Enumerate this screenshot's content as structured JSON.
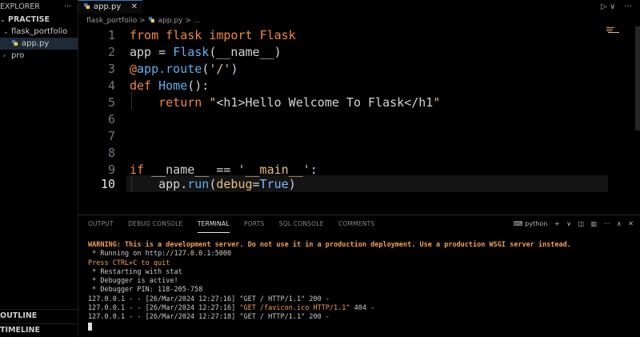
{
  "sidebar": {
    "header": "EXPLORER",
    "header_more": "···",
    "section": "PRACTISE",
    "items": [
      {
        "label": "flask_portfolio",
        "type": "folder",
        "expanded": true
      },
      {
        "label": "app.py",
        "type": "python-file",
        "selected": true
      },
      {
        "label": "pro",
        "type": "folder",
        "expanded": false
      }
    ],
    "outline": "OUTLINE",
    "timeline": "TIMELINE"
  },
  "tab": {
    "label": "app.py",
    "close": "✕"
  },
  "tab_actions": {
    "run": "▷",
    "chev": "∨",
    "more": "···"
  },
  "breadcrumb": {
    "folder": "flask_portfolio",
    "sep": ">",
    "file": "app.py",
    "tail": "> ..."
  },
  "editor": {
    "current_line": 10,
    "line_numbers": [
      "1",
      "2",
      "3",
      "4",
      "5",
      "6",
      "7",
      "8",
      "9",
      "10"
    ]
  },
  "panel": {
    "tabs": [
      "OUTPUT",
      "DEBUG CONSOLE",
      "TERMINAL",
      "PORTS",
      "SQL CONSOLE",
      "COMMENTS"
    ],
    "active_tab": "TERMINAL",
    "shell": "python",
    "actions": {
      "add": "+",
      "split": "◫",
      "trash": "🗑",
      "more": "···",
      "max": "∧",
      "close": "✕"
    }
  },
  "terminal": {
    "warning": "WARNING: This is a development server. Do not use it in a production deployment. Use a production WSGI server instead.",
    "running": " * Running on http://127.0.0.1:5000",
    "quit": "Press CTRL+C to quit",
    "restart": " * Restarting with stat",
    "debugger": " * Debugger is active!",
    "pin": " * Debugger PIN: 118-205-758",
    "log1": "127.0.0.1 - - [26/Mar/2024 12:27:16] \"GET / HTTP/1.1\" 200 -",
    "log2_a": "127.0.0.1 - - [26/Mar/2024 12:27:16] ",
    "log2_b": "\"GET /favicon.ico HTTP/1.1\"",
    "log2_c": " 404 -",
    "log3": "127.0.0.1 - - [26/Mar/2024 12:27:18] \"GET / HTTP/1.1\" 200 -"
  }
}
